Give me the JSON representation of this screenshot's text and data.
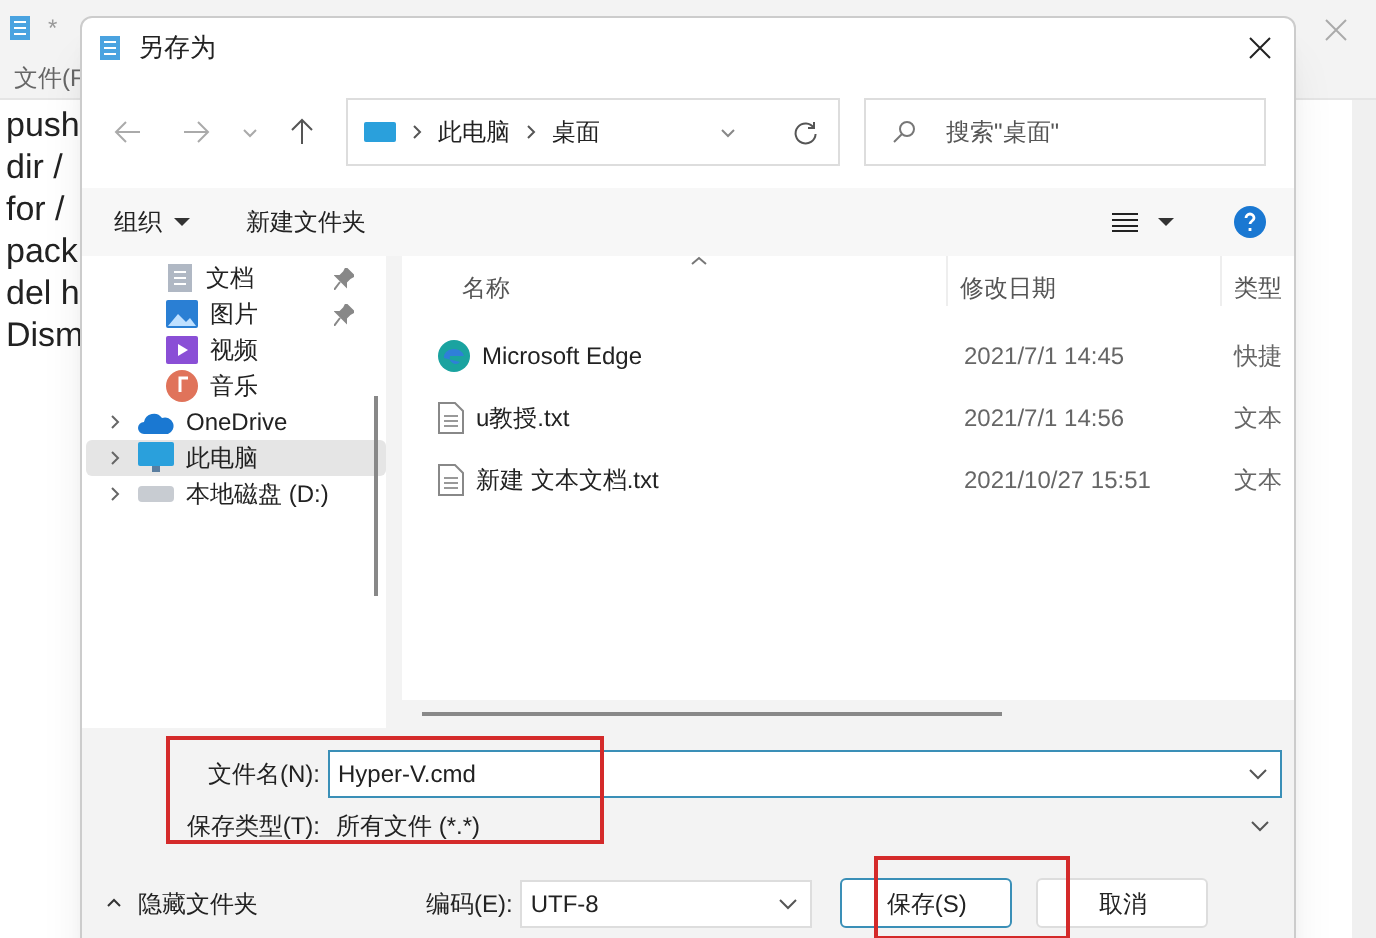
{
  "background_window": {
    "title": "*",
    "menu": "文件(F",
    "lines": [
      "push",
      "dir /",
      "for /",
      "pack",
      "del h",
      "Dism"
    ]
  },
  "dialog": {
    "title": "另存为",
    "breadcrumb": [
      "此电脑",
      "桌面"
    ],
    "search": {
      "placeholder": "搜索\"桌面\""
    },
    "toolbar": {
      "organize": "组织",
      "new_folder": "新建文件夹"
    },
    "sidebar": {
      "items": [
        {
          "label": "文档",
          "kind": "documents",
          "pinned": true,
          "expandable": false,
          "selected": false
        },
        {
          "label": "图片",
          "kind": "pictures",
          "pinned": true,
          "expandable": false,
          "selected": false
        },
        {
          "label": "视频",
          "kind": "videos",
          "pinned": false,
          "expandable": false,
          "selected": false
        },
        {
          "label": "音乐",
          "kind": "music",
          "pinned": false,
          "expandable": false,
          "selected": false
        },
        {
          "label": "OneDrive",
          "kind": "cloud",
          "pinned": false,
          "expandable": true,
          "selected": false
        },
        {
          "label": "此电脑",
          "kind": "computer",
          "pinned": false,
          "expandable": true,
          "selected": true
        },
        {
          "label": "本地磁盘 (D:)",
          "kind": "drive",
          "pinned": false,
          "expandable": true,
          "selected": false
        }
      ]
    },
    "columns": [
      "名称",
      "修改日期",
      "类型"
    ],
    "files": [
      {
        "name": "Microsoft Edge",
        "kind": "shortcut",
        "date": "2021/7/1 14:45",
        "type": "快捷"
      },
      {
        "name": "u教授.txt",
        "kind": "text",
        "date": "2021/7/1 14:56",
        "type": "文本"
      },
      {
        "name": "新建 文本文档.txt",
        "kind": "text",
        "date": "2021/10/27 15:51",
        "type": "文本"
      }
    ],
    "file_name": {
      "label": "文件名(N):",
      "value": "Hyper-V.cmd"
    },
    "save_type": {
      "label": "保存类型(T):",
      "value": "所有文件 (*.*)"
    },
    "hide_folders": "隐藏文件夹",
    "encoding": {
      "label": "编码(E):",
      "value": "UTF-8"
    },
    "buttons": [
      "保存(S)",
      "取消"
    ]
  }
}
